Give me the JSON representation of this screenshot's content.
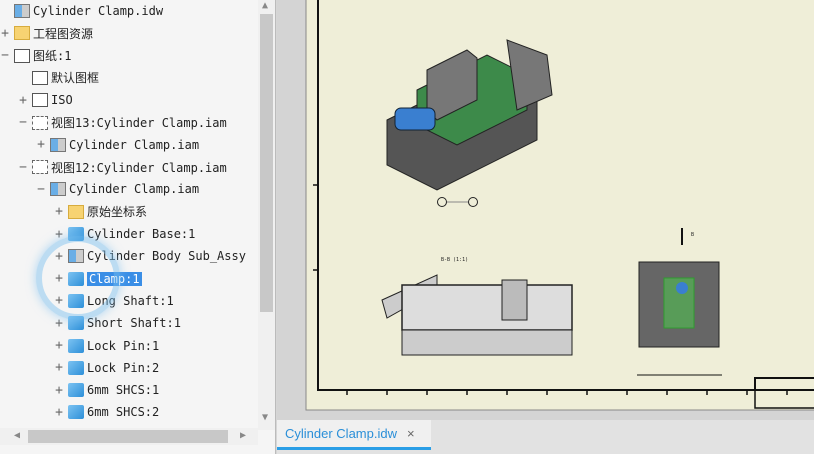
{
  "browser": {
    "items": [
      {
        "label": "Cylinder Clamp.idw",
        "icon": "drawing-icon",
        "toggle": "",
        "indent": 0
      },
      {
        "label": "工程图资源",
        "icon": "folder-icon",
        "toggle": "+",
        "indent": 0
      },
      {
        "label": "图纸:1",
        "icon": "sheet-icon",
        "toggle": "−",
        "indent": 0
      },
      {
        "label": "默认图框",
        "icon": "border-icon",
        "toggle": "",
        "indent": 1
      },
      {
        "label": "ISO",
        "icon": "title-block-icon",
        "toggle": "+",
        "indent": 1
      },
      {
        "label": "视图13:Cylinder Clamp.iam",
        "icon": "view-icon",
        "toggle": "−",
        "indent": 1
      },
      {
        "label": "Cylinder Clamp.iam",
        "icon": "assembly-icon",
        "toggle": "+",
        "indent": 2
      },
      {
        "label": "视图12:Cylinder Clamp.iam",
        "icon": "view-icon",
        "toggle": "−",
        "indent": 1
      },
      {
        "label": "Cylinder Clamp.iam",
        "icon": "assembly-icon",
        "toggle": "−",
        "indent": 2
      },
      {
        "label": "原始坐标系",
        "icon": "folder-icon",
        "toggle": "+",
        "indent": 3
      },
      {
        "label": "Cylinder Base:1",
        "icon": "part-icon",
        "toggle": "+",
        "indent": 3
      },
      {
        "label": "Cylinder Body Sub_Assy",
        "icon": "subassembly-icon",
        "toggle": "+",
        "indent": 3
      },
      {
        "label": "Clamp:1",
        "icon": "part-icon",
        "toggle": "+",
        "indent": 3,
        "selected": true
      },
      {
        "label": "Long Shaft:1",
        "icon": "part-icon",
        "toggle": "+",
        "indent": 3
      },
      {
        "label": "Short Shaft:1",
        "icon": "part-icon",
        "toggle": "+",
        "indent": 3
      },
      {
        "label": "Lock Pin:1",
        "icon": "part-icon",
        "toggle": "+",
        "indent": 3
      },
      {
        "label": "Lock Pin:2",
        "icon": "part-icon",
        "toggle": "+",
        "indent": 3
      },
      {
        "label": "6mm SHCS:1",
        "icon": "part-icon",
        "toggle": "+",
        "indent": 3
      },
      {
        "label": "6mm SHCS:2",
        "icon": "part-icon",
        "toggle": "+",
        "indent": 3
      }
    ]
  },
  "drawing": {
    "section_label": "B-B (1:1)",
    "cut_label": "B"
  },
  "tabs": [
    {
      "label": "Cylinder Clamp.idw",
      "close": "×"
    }
  ]
}
